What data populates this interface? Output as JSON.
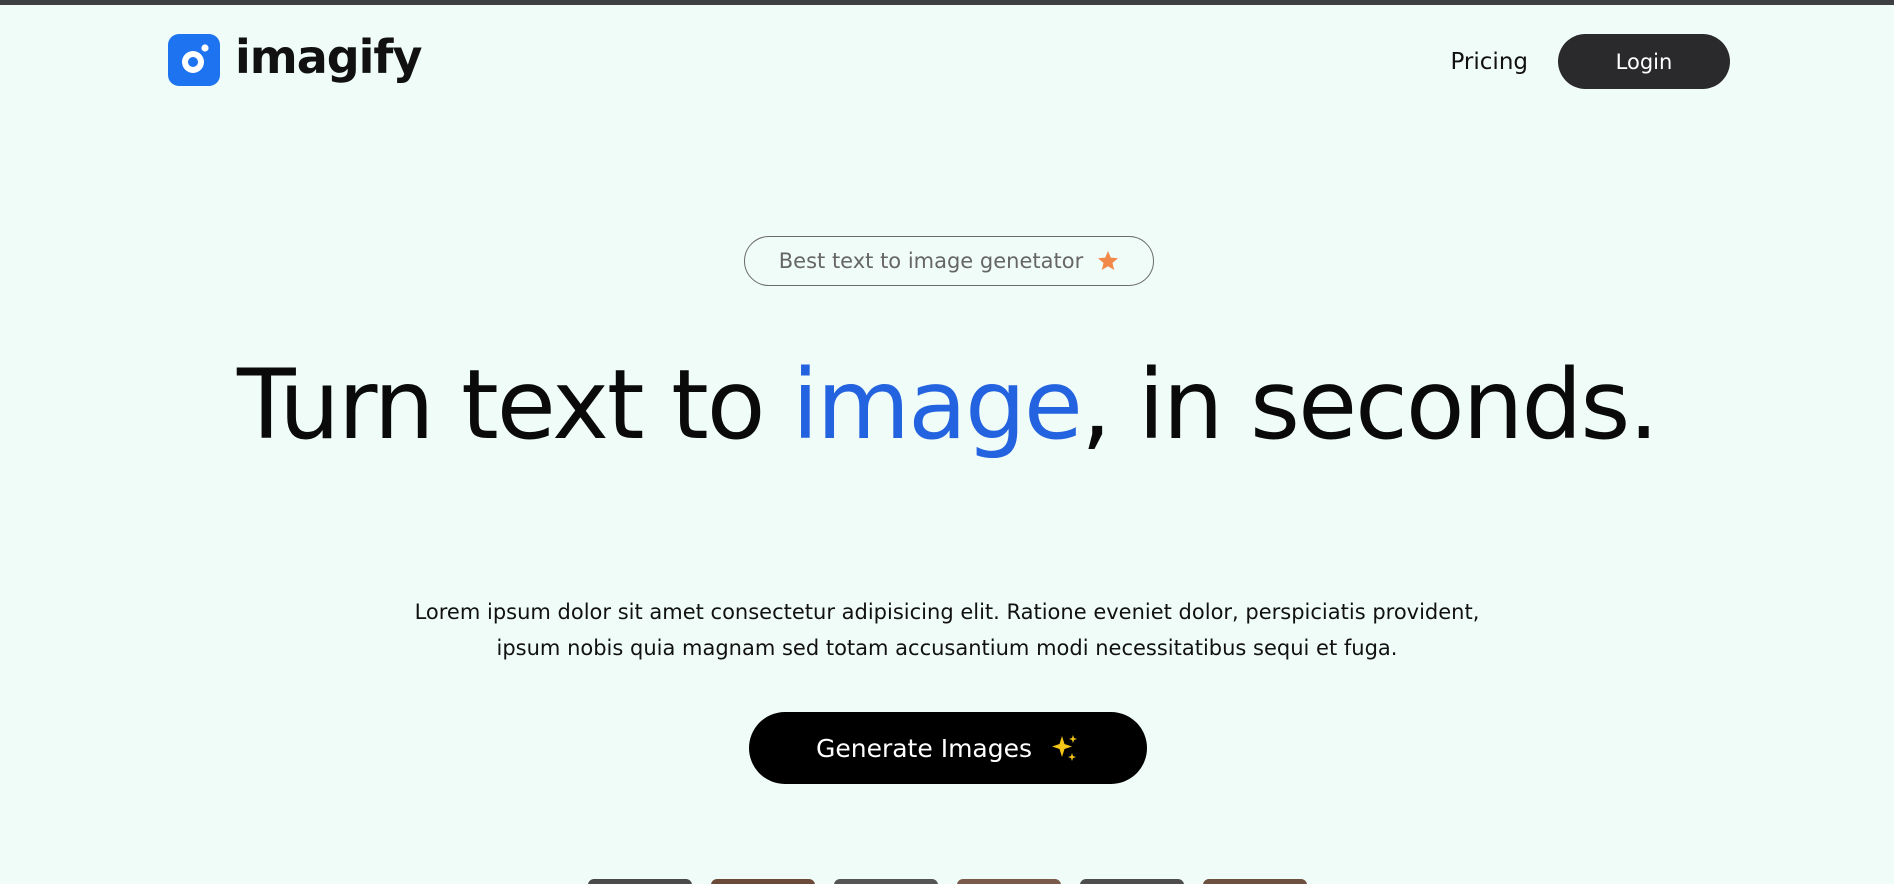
{
  "brand": {
    "name": "imagify",
    "logo_icon": "camera-lens-icon",
    "color": "#1d73f0"
  },
  "nav": {
    "pricing_label": "Pricing",
    "login_label": "Login"
  },
  "hero": {
    "badge_text": "Best text to image genetator",
    "badge_icon": "star-icon",
    "title_part1": "Turn text to ",
    "title_accent": "image",
    "title_part2": ", in seconds.",
    "accent_color": "#2463e0",
    "description": "Lorem ipsum dolor sit amet consectetur adipisicing elit. Ratione eveniet dolor, perspiciatis provident, ipsum nobis quia magnam sed totam accusantium modi necessitatibus sequi et fuga.",
    "cta_label": "Generate Images",
    "cta_icon": "sparkles-icon"
  },
  "thumbnails": [
    {
      "color": "#4a4a4a"
    },
    {
      "color": "#6b4a3a"
    },
    {
      "color": "#555555"
    },
    {
      "color": "#7a5a4a"
    },
    {
      "color": "#4d4d4d"
    },
    {
      "color": "#6e5040"
    }
  ]
}
